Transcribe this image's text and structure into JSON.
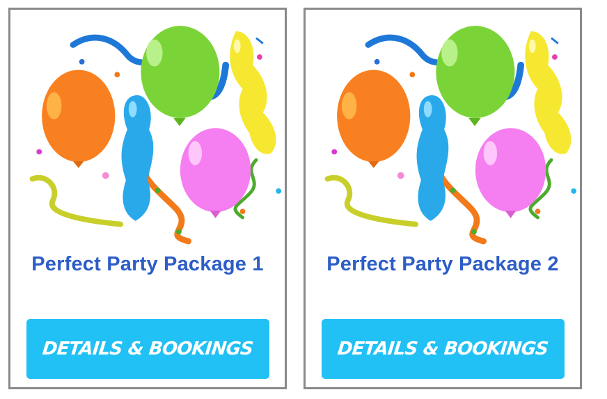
{
  "cards": [
    {
      "image": "balloons-illustration",
      "title": "Perfect Party Package 1",
      "button_label": "DETAILS & BOOKINGS"
    },
    {
      "image": "balloons-illustration",
      "title": "Perfect Party Package 2",
      "button_label": "DETAILS & BOOKINGS"
    }
  ],
  "colors": {
    "title": "#2d5dc6",
    "button": "#21c0f5",
    "card_border": "#8a8a8a"
  }
}
